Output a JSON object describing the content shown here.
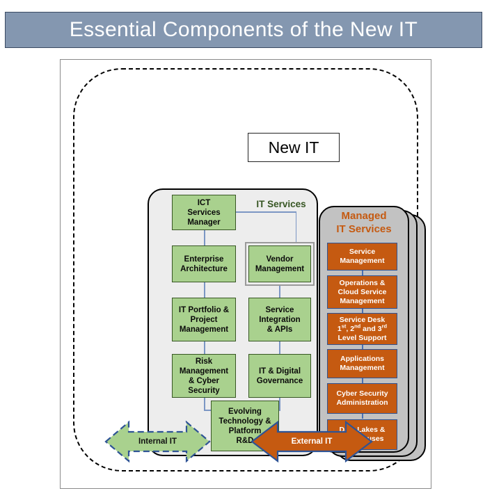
{
  "header": {
    "title": "Essential Components of the New IT",
    "bar_color": "#8497B0",
    "text_color": "#FFFFFF"
  },
  "diagram": {
    "boundary_label": "New IT",
    "colors": {
      "green_fill": "#A9D18E",
      "green_border": "#375623",
      "orange_fill": "#C55A11",
      "orange_border": "#2E5395",
      "panel_light_gray": "#EDEDED",
      "panel_dark_gray": "#C2C2C2",
      "connector": "#7B96C4"
    },
    "it_services": {
      "title": "IT Services",
      "title_color": "#375623",
      "root": {
        "label": "ICT Services Manager"
      },
      "left_column": [
        {
          "label": "Enterprise Architecture"
        },
        {
          "label": "IT Portfolio & Project Management"
        },
        {
          "label": "Risk Management & Cyber Security"
        }
      ],
      "right_column": [
        {
          "label": "Vendor Management",
          "highlighted": true
        },
        {
          "label": "Service Integration & APIs"
        },
        {
          "label": "IT & Digital Governance"
        }
      ],
      "bottom": {
        "label": "Evolving Technology & Platform R&D"
      }
    },
    "managed_it_services": {
      "title": "Managed IT Services",
      "title_color": "#C55A11",
      "stack_count": 3,
      "items": [
        {
          "label": "Service Management"
        },
        {
          "label": "Operations & Cloud Service Management"
        },
        {
          "label": "Service Desk 1st, 2nd and 3rd Level Support"
        },
        {
          "label": "Applications Management"
        },
        {
          "label": "Cyber Security Administration"
        },
        {
          "label": "Data Lakes & Warehouses"
        }
      ]
    },
    "arrows": [
      {
        "label": "Internal IT",
        "fill": "#A9D18E",
        "border": "#2E5395",
        "border_style": "dashed",
        "text_color": "#111111"
      },
      {
        "label": "External IT",
        "fill": "#C55A11",
        "border": "#2E5395",
        "border_style": "solid",
        "text_color": "#FFFFFF"
      }
    ]
  }
}
